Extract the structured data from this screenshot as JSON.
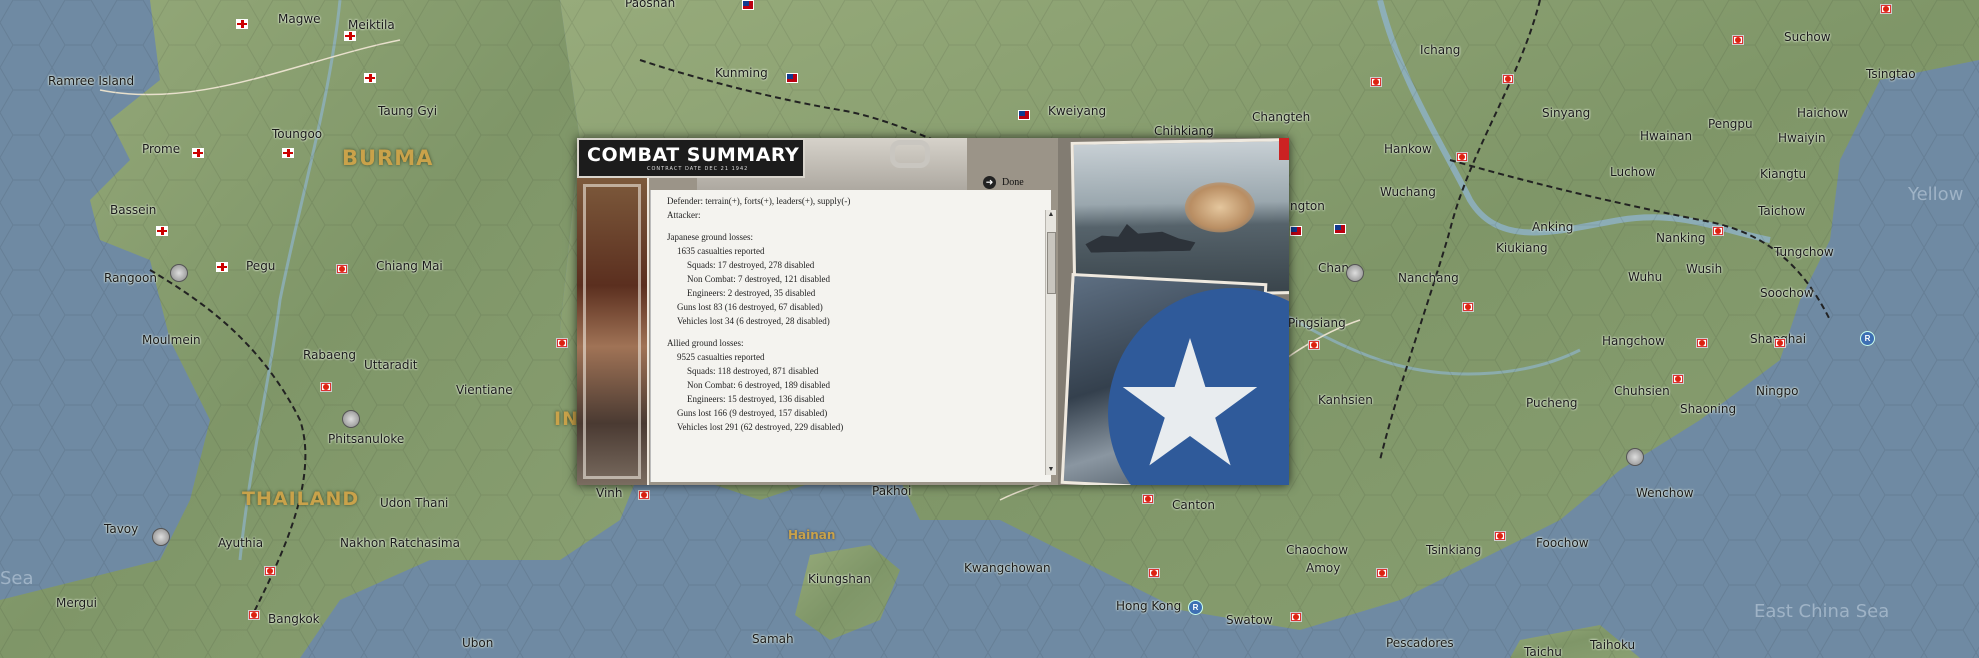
{
  "map": {
    "regions": [
      "BURMA",
      "THAILAND",
      "IN"
    ],
    "places": [
      "Magwe",
      "Meiktila",
      "Paoshan",
      "Ramree Island",
      "Kunming",
      "Kweiyang",
      "Chihkiang",
      "Changteh",
      "Taung Gyi",
      "Toungoo",
      "Prome",
      "Bassein",
      "Rangoon",
      "Pegu",
      "Chiang Mai",
      "Moulmein",
      "Rabaeng",
      "Uttaradit",
      "Vientiane",
      "Phitsanuloke",
      "Udon Thani",
      "Tavoy",
      "Ayuthia",
      "Nakhon Ratchasima",
      "Mergui",
      "Bangkok",
      "Ubon",
      "Vinh",
      "Pakhoi",
      "Hainan",
      "Kiungshan",
      "Samah",
      "Kwangchowan",
      "Canton",
      "Hong Kong",
      "Swatow",
      "Amoy",
      "Chaochow",
      "Tsinkiang",
      "Foochow",
      "Pescadores",
      "Taichu",
      "Taihoku",
      "Ichang",
      "Hankow",
      "Sinyang",
      "Hwainan",
      "Pengpu",
      "Hwaiyin",
      "Tsingtao",
      "Suchow",
      "Haichow",
      "Luchow",
      "Kiangtu",
      "Taichow",
      "Wuchang",
      "Anking",
      "Kiukiang",
      "Nanking",
      "Wusih",
      "Wuhu",
      "Soochow",
      "Tungchow",
      "Nanchang",
      "Hangchow",
      "Shanghai",
      "Pingsiang",
      "Chuhsien",
      "Ningpo",
      "Shaoning",
      "Kanhsien",
      "Pucheng",
      "Wenchow",
      "Yellow",
      "East China Sea",
      "Sea",
      "ngton",
      "Chan"
    ]
  },
  "dialog": {
    "title": "COMBAT SUMMARY",
    "subtitle": "CONTRACT DATE DEC 21 1942",
    "done_label": "Done",
    "lines": {
      "defender": "Defender: terrain(+), forts(+), leaders(+), supply(-)",
      "attacker": "Attacker:",
      "jp_header": "Japanese ground losses:",
      "jp_casualties": "1635 casualties reported",
      "jp_squads": "Squads: 17 destroyed, 278 disabled",
      "jp_noncombat": "Non Combat: 7 destroyed, 121 disabled",
      "jp_engineers": "Engineers: 2 destroyed, 35 disabled",
      "jp_guns": "Guns lost 83 (16 destroyed, 67 disabled)",
      "jp_vehicles": "Vehicles lost 34 (6 destroyed, 28 disabled)",
      "al_header": "Allied ground losses:",
      "al_casualties": "9525 casualties reported",
      "al_squads": "Squads: 118 destroyed, 871 disabled",
      "al_noncombat": "Non Combat: 6 destroyed, 189 disabled",
      "al_engineers": "Engineers: 15 destroyed, 136 disabled",
      "al_guns": "Guns lost 166 (9 destroyed, 157 disabled)",
      "al_vehicles": "Vehicles lost 291 (62 destroyed, 229 disabled)"
    }
  },
  "colors": {
    "sea": "#6f8aa3",
    "land": "#8fa574",
    "region_label": "#c9a24a",
    "paper": "#f4f3ef"
  },
  "icons": [
    "uk-flag-icon",
    "japan-flag-icon",
    "china-flag-icon",
    "fort-icon",
    "port-r-icon",
    "done-arrow-icon",
    "scroll-up-icon",
    "scroll-down-icon"
  ]
}
